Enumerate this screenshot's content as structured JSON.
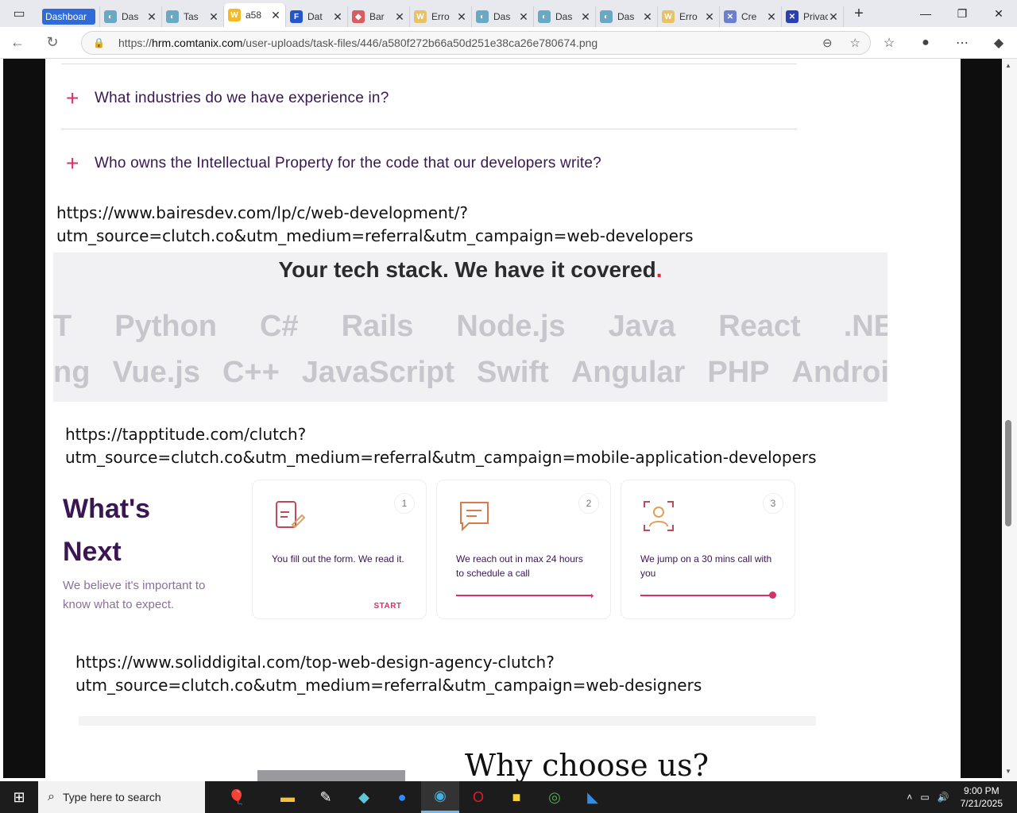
{
  "tabs": [
    {
      "label": "Dashboar",
      "icon_color": "#2e6bd6",
      "glyph": "",
      "first": true
    },
    {
      "label": "Das",
      "icon_color": "#6aa9c4",
      "glyph": "◐"
    },
    {
      "label": "Tas",
      "icon_color": "#6aa9c4",
      "glyph": "◐"
    },
    {
      "label": "a58",
      "icon_color": "#f2b928",
      "glyph": "W",
      "active": true
    },
    {
      "label": "Dat",
      "icon_color": "#2456c8",
      "glyph": "F"
    },
    {
      "label": "Bar",
      "icon_color": "#d95c63",
      "glyph": "◆"
    },
    {
      "label": "Erro",
      "icon_color": "#e6c36a",
      "glyph": "W"
    },
    {
      "label": "Das",
      "icon_color": "#6aa9c4",
      "glyph": "◐"
    },
    {
      "label": "Das",
      "icon_color": "#6aa9c4",
      "glyph": "◐"
    },
    {
      "label": "Das",
      "icon_color": "#6aa9c4",
      "glyph": "◐"
    },
    {
      "label": "Erro",
      "icon_color": "#e6c36a",
      "glyph": "W"
    },
    {
      "label": "Cre",
      "icon_color": "#6b7fd0",
      "glyph": "✕"
    },
    {
      "label": "Privacy",
      "icon_color": "#2a3fb0",
      "glyph": "✕"
    }
  ],
  "address": {
    "scheme": "https://",
    "host": "hrm.comtanix.com",
    "path": "/user-uploads/task-files/446/a580f272b66a50d251e38ca26e780674.png"
  },
  "faq": [
    "What industries do we have experience in?",
    "Who owns the Intellectual Property for the code that our developers write?"
  ],
  "links": {
    "bairesdev_1": "https://www.bairesdev.com/lp/c/web-development/?",
    "bairesdev_2": "utm_source=clutch.co&utm_medium=referral&utm_campaign=web-developers",
    "tapptitude_1": "https://tapptitude.com/clutch?",
    "tapptitude_2": "utm_source=clutch.co&utm_medium=referral&utm_campaign=mobile-application-developers",
    "soliddigital_1": "https://www.soliddigital.com/top-web-design-agency-clutch?",
    "soliddigital_2": "utm_source=clutch.co&utm_medium=referral&utm_campaign=web-designers"
  },
  "stack": {
    "title": "Your tech stack. We have it covered",
    "title_dot": ".",
    "row1": [
      "T",
      "Python",
      "C#",
      "Rails",
      "Node.js",
      "Java",
      "React",
      ".NE"
    ],
    "row2": [
      "ng",
      "Vue.js",
      "C++",
      "JavaScript",
      "Swift",
      "Angular",
      "PHP",
      "Androi"
    ]
  },
  "next": {
    "title_1": "What's",
    "title_2": "Next",
    "subtitle": "We believe it's important to know what to expect.",
    "steps": [
      {
        "num": "1",
        "text": "You fill out the form. We read it.",
        "cta": "START"
      },
      {
        "num": "2",
        "text": "We reach out in max 24 hours to schedule a call"
      },
      {
        "num": "3",
        "text": "We jump on a 30 mins call with you"
      }
    ]
  },
  "why": "Why choose us?",
  "taskbar": {
    "search_placeholder": "Type here to search",
    "time": "9:00 PM",
    "date": "7/21/2025"
  },
  "colors": {
    "accent": "#d4306a",
    "purple": "#3a1653"
  }
}
